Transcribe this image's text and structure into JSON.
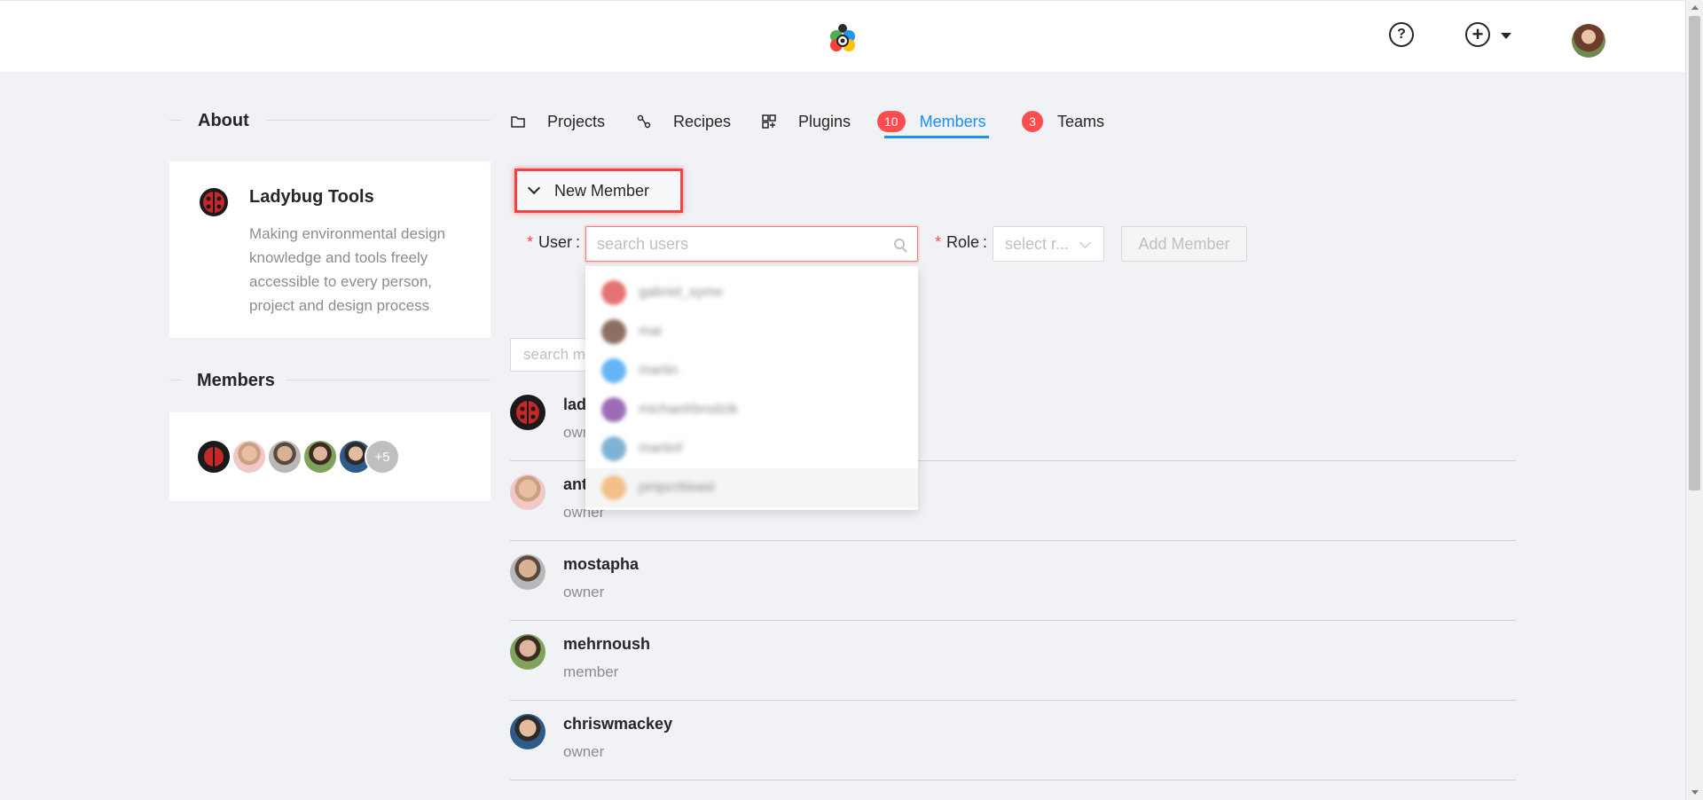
{
  "header": {
    "logo_icon": "ladybug-tools-logo-icon",
    "help_icon": "question-circle-icon",
    "help_glyph": "?",
    "create_icon": "plus-circle-icon",
    "create_glyph": "+",
    "user_avatar": "user-avatar"
  },
  "sidebar": {
    "about_title": "About",
    "org": {
      "name": "Ladybug Tools",
      "description": "Making environmental design knowledge and tools freely accessible to every person, project and design process"
    },
    "members_title": "Members",
    "member_avatars_more": "+5"
  },
  "tabs": [
    {
      "label": "Projects",
      "icon": "folder-icon"
    },
    {
      "label": "Recipes",
      "icon": "recipe-icon"
    },
    {
      "label": "Plugins",
      "icon": "plugin-icon"
    },
    {
      "label": "Members",
      "badge": "10",
      "active": true
    },
    {
      "label": "Teams",
      "badge": "3"
    }
  ],
  "new_member": {
    "toggle_label": "New Member",
    "user_label": "User",
    "user_placeholder": "search users",
    "role_label": "Role",
    "role_placeholder": "select r...",
    "add_button": "Add Member",
    "required_mark": "*",
    "label_colon": ":"
  },
  "dropdown": {
    "items": [
      "gabriel_syme",
      "mai",
      "martin",
      "michaelrbrodzik",
      "martinf",
      "pmpcritieasl"
    ]
  },
  "members_search": {
    "placeholder": "search m"
  },
  "members": [
    {
      "name": "lad",
      "role": "own"
    },
    {
      "name": "ant",
      "role": "owner"
    },
    {
      "name": "mostapha",
      "role": "owner"
    },
    {
      "name": "mehrnoush",
      "role": "member"
    },
    {
      "name": "chriswmackey",
      "role": "owner"
    }
  ],
  "colors": {
    "accent": "#1890ff",
    "badge": "#ff4d4f",
    "highlight": "#ef4444"
  }
}
